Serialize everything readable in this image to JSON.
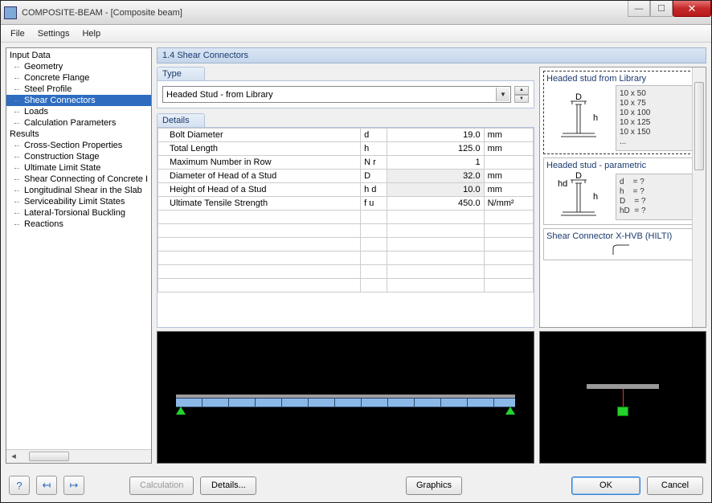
{
  "window": {
    "title": "COMPOSITE-BEAM - [Composite beam]"
  },
  "menu": {
    "file": "File",
    "settings": "Settings",
    "help": "Help"
  },
  "tree": {
    "input_data": "Input Data",
    "items_input": [
      "Geometry",
      "Concrete Flange",
      "Steel Profile",
      "Shear Connectors",
      "Loads",
      "Calculation Parameters"
    ],
    "results": "Results",
    "items_results": [
      "Cross-Section Properties",
      "Construction Stage",
      "Ultimate Limit State",
      "Shear Connecting of Concrete I",
      "Longitudinal Shear in the Slab",
      "Serviceability Limit States",
      "Lateral-Torsional Buckling",
      "Reactions"
    ],
    "selected": "Shear Connectors"
  },
  "section": {
    "num_title": "1.4 Shear Connectors"
  },
  "type": {
    "label": "Type",
    "value": "Headed Stud - from Library"
  },
  "details": {
    "label": "Details",
    "rows": [
      {
        "name": "Bolt Diameter",
        "sym": "d",
        "val": "19.0",
        "unit": "mm",
        "gray": false
      },
      {
        "name": "Total Length",
        "sym": "h",
        "val": "125.0",
        "unit": "mm",
        "gray": false
      },
      {
        "name": "Maximum Number in Row",
        "sym": "N r",
        "val": "1",
        "unit": "",
        "gray": false
      },
      {
        "name": "Diameter of Head of a Stud",
        "sym": "D",
        "val": "32.0",
        "unit": "mm",
        "gray": true
      },
      {
        "name": "Height of Head of a Stud",
        "sym": "h d",
        "val": "10.0",
        "unit": "mm",
        "gray": true
      },
      {
        "name": "Ultimate Tensile Strength",
        "sym": "f u",
        "val": "450.0",
        "unit": "N/mm²",
        "gray": false
      }
    ]
  },
  "library": {
    "item1": {
      "title": "Headed stud from Library",
      "list": "10 x 50\n10 x 75\n10 x 100\n10 x 125\n10 x 150\n..."
    },
    "item2": {
      "title": "Headed stud - parametric",
      "list": "d    = ?\nh    = ?\nD    = ?\nhD  = ?"
    },
    "item3": {
      "title": "Shear Connector X-HVB (HILTI)"
    }
  },
  "footer": {
    "calculation": "Calculation",
    "details": "Details...",
    "graphics": "Graphics",
    "ok": "OK",
    "cancel": "Cancel"
  }
}
